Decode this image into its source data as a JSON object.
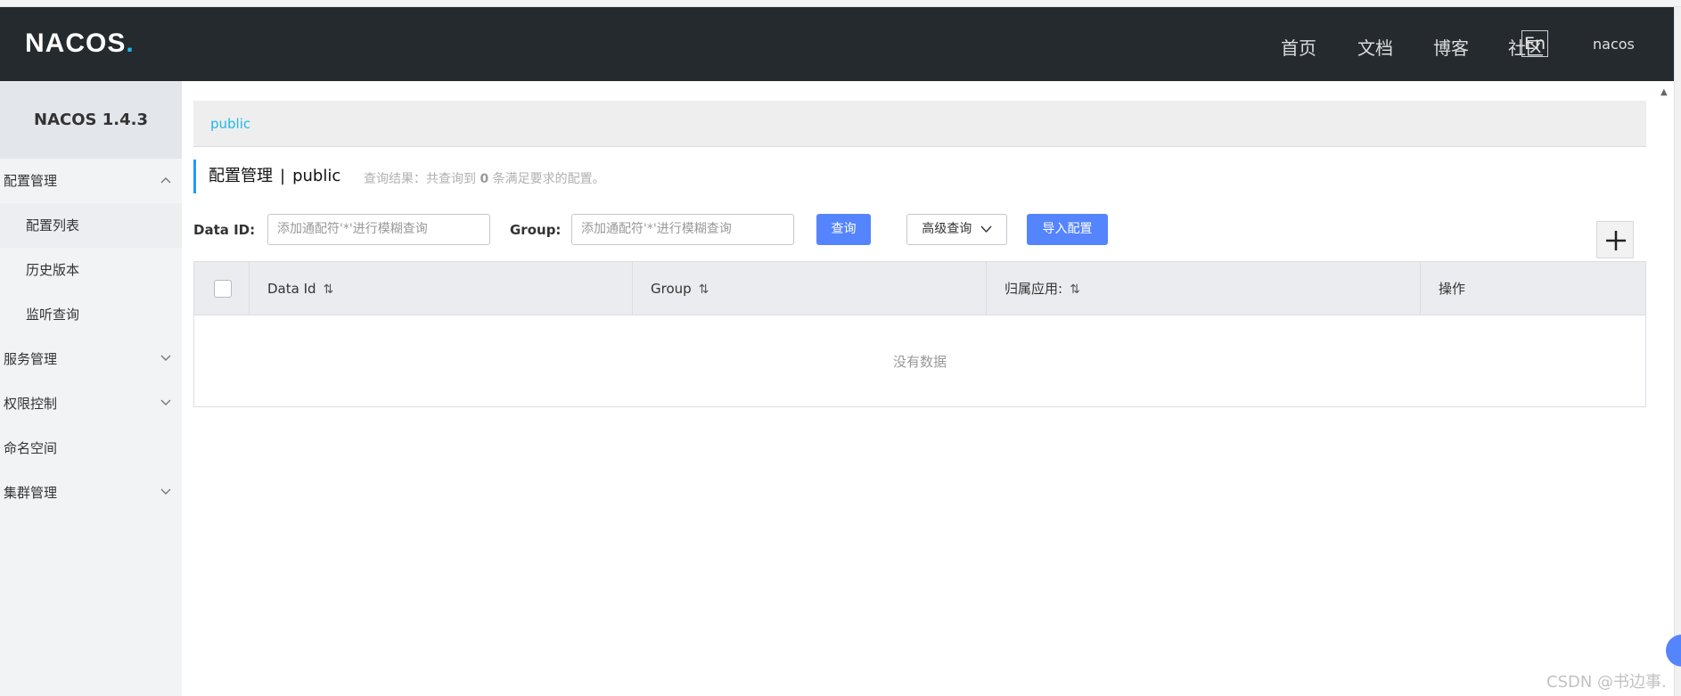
{
  "header": {
    "logo": "NACOS",
    "logo_dot": ".",
    "nav": [
      "首页",
      "文档",
      "博客",
      "社区"
    ],
    "lang": "En",
    "user": "nacos"
  },
  "sidebar": {
    "title": "NACOS 1.4.3",
    "groups": [
      {
        "label": "配置管理",
        "expanded": true,
        "items": [
          "配置列表",
          "历史版本",
          "监听查询"
        ]
      },
      {
        "label": "服务管理",
        "expanded": false
      },
      {
        "label": "权限控制",
        "expanded": false
      },
      {
        "label": "命名空间"
      },
      {
        "label": "集群管理",
        "expanded": false
      }
    ]
  },
  "main": {
    "breadcrumb": "public",
    "title": "配置管理",
    "separator": "|",
    "namespace": "public",
    "result_prefix": "查询结果：共查询到",
    "result_count": "0",
    "result_suffix": "条满足要求的配置。",
    "filters": {
      "data_id_label": "Data ID:",
      "data_id_placeholder": "添加通配符'*'进行模糊查询",
      "group_label": "Group:",
      "group_placeholder": "添加通配符'*'进行模糊查询",
      "query_button": "查询",
      "advanced_button": "高级查询",
      "import_button": "导入配置"
    },
    "table": {
      "columns": [
        "Data Id",
        "Group",
        "归属应用:",
        "操作"
      ],
      "empty_text": "没有数据"
    }
  },
  "watermark": "CSDN @书边事.",
  "colors": {
    "header_bg": "#252a2f",
    "accent": "#1fb8ec",
    "primary_button": "#5584ff"
  }
}
